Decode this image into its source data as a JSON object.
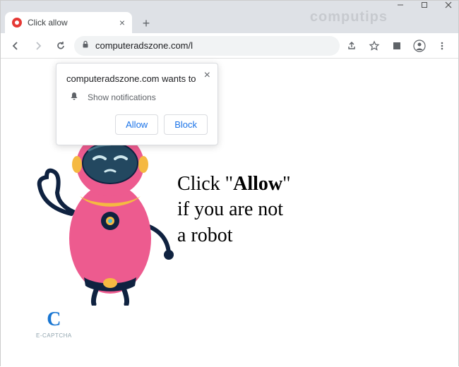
{
  "window": {
    "watermark": "computips"
  },
  "tab": {
    "title": "Click allow"
  },
  "toolbar": {
    "url": "computeradszone.com/l"
  },
  "permission": {
    "origin_wants": "computeradszone.com wants to",
    "capability": "Show notifications",
    "allow_label": "Allow",
    "block_label": "Block"
  },
  "page": {
    "line1_pre": "Click \"",
    "line1_bold": "Allow",
    "line1_post": "\"",
    "line2": "if you are not",
    "line3": "a robot",
    "captcha_label": "E-CAPTCHA"
  }
}
